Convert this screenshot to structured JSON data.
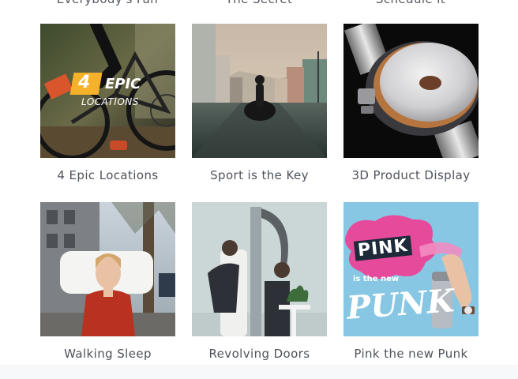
{
  "top_captions": [
    "Everybody's Fan",
    "The Secret",
    "Schedule it"
  ],
  "videos": [
    {
      "title": "4 Epic Locations",
      "overlay_number": "4",
      "overlay_word": "EPIC",
      "overlay_sub": "LOCATIONS",
      "accent": "#f5b12a"
    },
    {
      "title": "Sport is the Key"
    },
    {
      "title": "3D Product Display"
    },
    {
      "title": "Walking Sleep"
    },
    {
      "title": "Revolving Doors"
    },
    {
      "title": "Pink the new Punk",
      "overlay_word": "PINK",
      "overlay_sub": "is the new",
      "overlay_big": "PUNK",
      "accent": "#e64a9a"
    }
  ]
}
